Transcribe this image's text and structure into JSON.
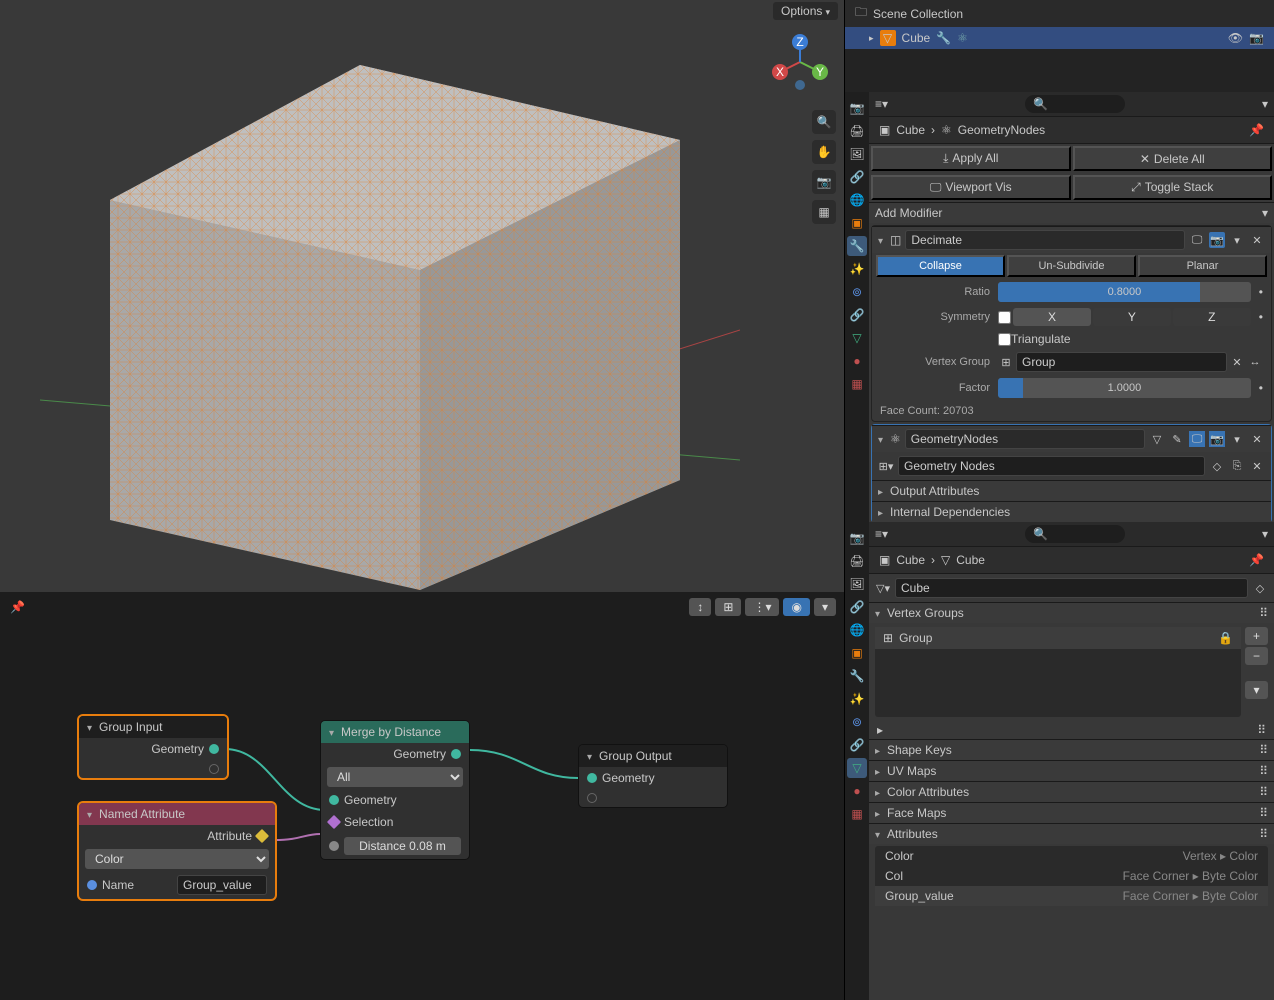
{
  "viewport": {
    "options": "Options"
  },
  "outliner": {
    "scene": "Scene Collection",
    "object": "Cube"
  },
  "propsTop": {
    "obj": "Cube",
    "mod": "GeometryNodes",
    "applyAll": "Apply All",
    "deleteAll": "Delete All",
    "viewportVis": "Viewport Vis",
    "toggleStack": "Toggle Stack",
    "addMod": "Add Modifier",
    "decimate": {
      "name": "Decimate",
      "tabs": [
        "Collapse",
        "Un-Subdivide",
        "Planar"
      ],
      "ratio_label": "Ratio",
      "ratio_val": "0.8000",
      "symmetry_label": "Symmetry",
      "axes": [
        "X",
        "Y",
        "Z"
      ],
      "triangulate": "Triangulate",
      "vgroup_label": "Vertex Group",
      "vgroup_val": "Group",
      "factor_label": "Factor",
      "factor_val": "1.0000",
      "facecount": "Face Count: 20703"
    },
    "gn": {
      "name": "GeometryNodes",
      "ng": "Geometry Nodes",
      "out": "Output Attributes",
      "dep": "Internal Dependencies"
    }
  },
  "propsBot": {
    "obj": "Cube",
    "obj2": "Cube",
    "meshname": "Cube",
    "vg_panel": "Vertex Groups",
    "vg_item": "Group",
    "shape": "Shape Keys",
    "uv": "UV Maps",
    "cattr": "Color Attributes",
    "fmap": "Face Maps",
    "attr": "Attributes",
    "attrs": [
      {
        "n": "Color",
        "d": "Vertex ▸ Color"
      },
      {
        "n": "Col",
        "d": "Face Corner ▸ Byte Color"
      },
      {
        "n": "Group_value",
        "d": "Face Corner ▸ Byte Color"
      }
    ]
  },
  "nodes": {
    "groupInput": {
      "title": "Group Input",
      "sock": "Geometry"
    },
    "namedAttr": {
      "title": "Named Attribute",
      "sock": "Attribute",
      "type": "Color",
      "nlabel": "Name",
      "nval": "Group_value"
    },
    "merge": {
      "title": "Merge by Distance",
      "out": "Geometry",
      "mode": "All",
      "in1": "Geometry",
      "in2": "Selection",
      "dist": "Distance  0.08 m"
    },
    "groupOutput": {
      "title": "Group Output",
      "sock": "Geometry"
    }
  }
}
